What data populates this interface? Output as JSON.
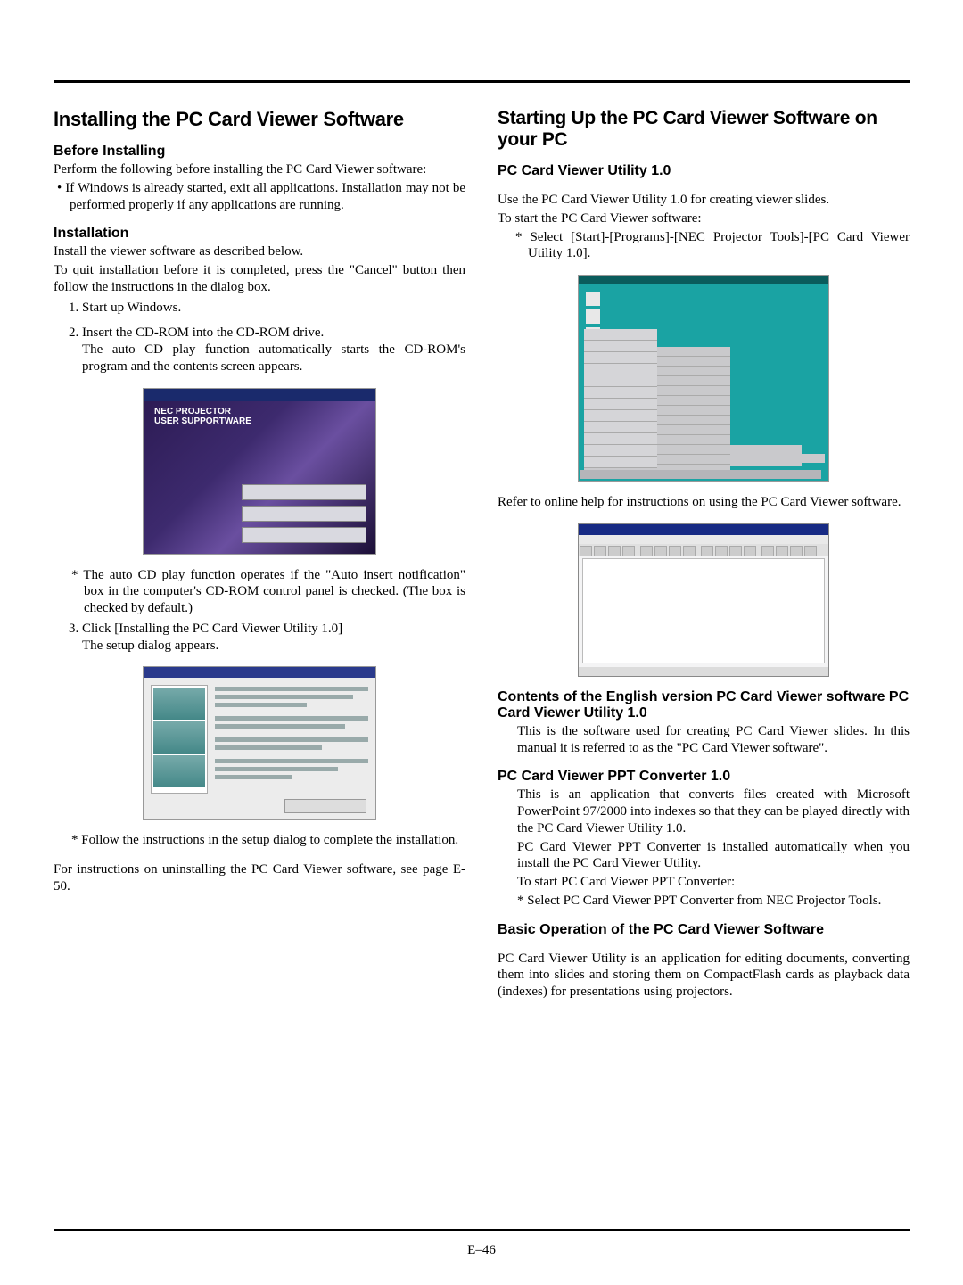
{
  "page_number": "E–46",
  "left": {
    "heading": "Installing the PC Card Viewer Software",
    "before_heading": "Before Installing",
    "before_text": "Perform the following before installing the PC Card Viewer software:",
    "before_bullet": "If Windows is already started, exit all applications.  Installation may not be performed properly if any applications are running.",
    "install_heading": "Installation",
    "install_p1": "Install the viewer software as described below.",
    "install_p2": "To quit installation before it is completed, press the \"Cancel\" button then follow the instructions in the dialog box.",
    "step1": "Start up Windows.",
    "step2a": "Insert the CD-ROM into the CD-ROM drive.",
    "step2b": "The auto CD play function automatically starts the CD-ROM's program and the contents screen appears.",
    "fig1_title1": "NEC PROJECTOR",
    "fig1_title2": "USER SUPPORTWARE",
    "note1": "The auto CD play function operates if the \"Auto insert notification\" box in the computer's CD-ROM control panel is checked. (The box is checked by default.)",
    "step3a": "Click [Installing the PC Card Viewer Utility 1.0]",
    "step3b": "The setup dialog appears.",
    "note2": "Follow the instructions in the setup dialog to complete the installation.",
    "uninstall_ref": "For instructions on uninstalling the PC Card Viewer software, see page E-50."
  },
  "right": {
    "heading": "Starting Up the PC Card Viewer Software on your PC",
    "sub1": "PC Card Viewer Utility 1.0",
    "p1": "Use the PC Card Viewer Utility 1.0 for creating viewer slides.",
    "p2": "To start the PC Card Viewer software:",
    "star1": "Select [Start]-[Programs]-[NEC Projector Tools]-[PC Card Viewer Utility 1.0].",
    "helpref": "Refer to online help for instructions on using the PC Card Viewer software.",
    "contents_heading": "Contents of the English version PC Card Viewer software PC Card Viewer Utility 1.0",
    "contents_text": "This is the software used for creating PC Card Viewer slides.  In this manual it is referred to as the \"PC Card Viewer software\".",
    "ppt_heading": "PC Card Viewer PPT Converter 1.0",
    "ppt_p1": "This is an application that converts files created with Microsoft PowerPoint 97/2000 into indexes so that they can be played directly with the PC Card Viewer Utility 1.0.",
    "ppt_p2": "PC Card Viewer PPT Converter is installed automatically when you install the PC Card Viewer Utility.",
    "ppt_p3": "To start PC Card Viewer PPT Converter:",
    "ppt_star": "Select PC Card Viewer PPT Converter from NEC Projector Tools.",
    "basic_heading": "Basic Operation of the PC Card Viewer Software",
    "basic_text": "PC Card Viewer Utility is an application for editing documents, converting them into slides and storing them on CompactFlash cards as playback data (indexes) for presentations using projectors."
  }
}
